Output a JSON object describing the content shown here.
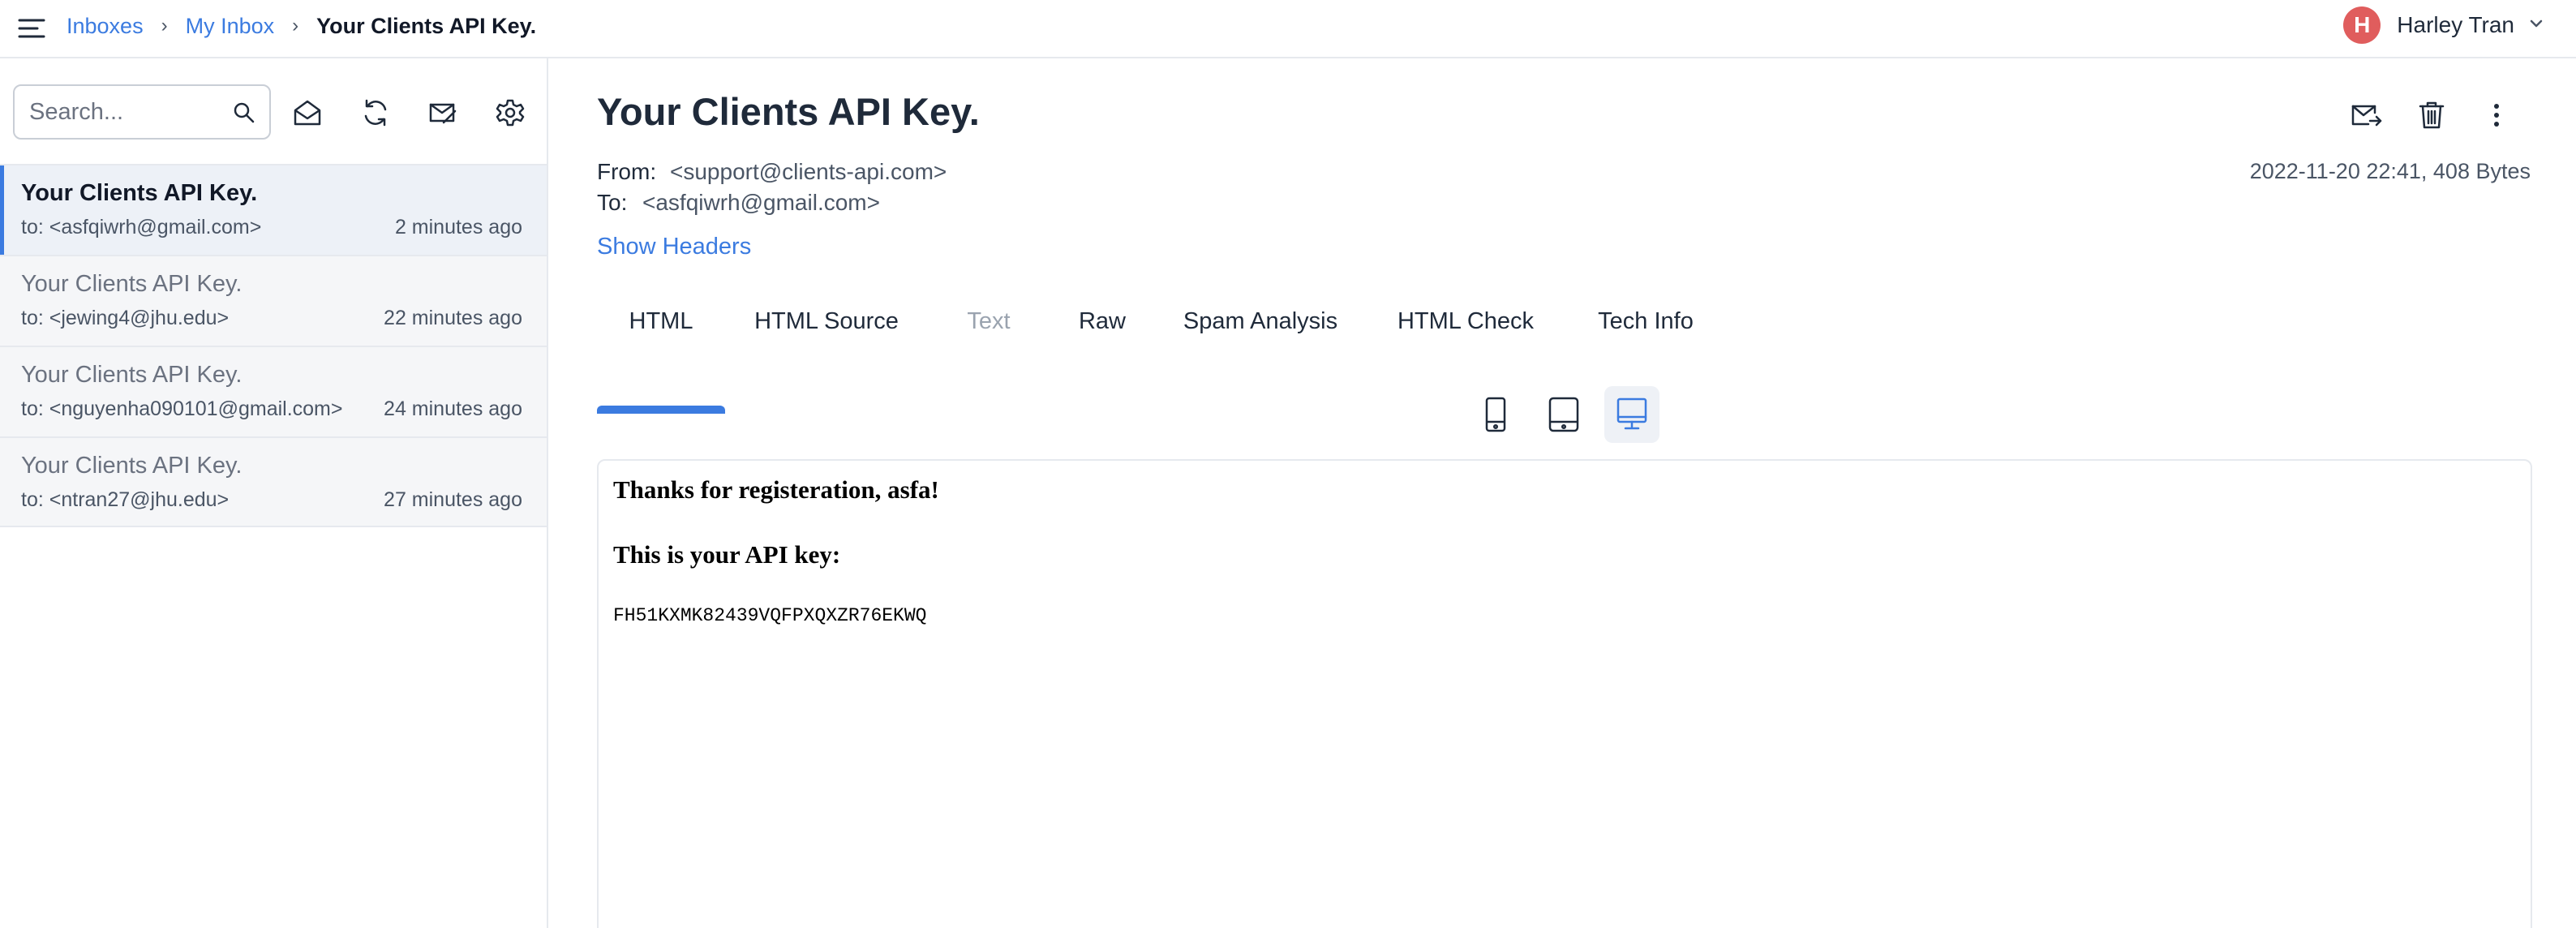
{
  "colors": {
    "accent": "#3b7be0",
    "avatar": "#e05d5d",
    "text": "#1f2a3a",
    "muted": "#6b7280"
  },
  "header": {
    "menu_icon": "hamburger-menu-icon",
    "breadcrumb": {
      "inboxes": "Inboxes",
      "my_inbox": "My Inbox",
      "current": "Your Clients API Key.",
      "separator": "›"
    },
    "user": {
      "initial": "H",
      "name": "Harley Tran"
    }
  },
  "sidebar": {
    "search": {
      "placeholder": "Search..."
    },
    "toolbar_icons": [
      "envelope-open-icon",
      "refresh-icon",
      "mark-read-icon",
      "settings-gear-icon"
    ],
    "messages": [
      {
        "subject": "Your Clients API Key.",
        "to": "to: <asfqiwrh@gmail.com>",
        "time": "2 minutes ago"
      },
      {
        "subject": "Your Clients API Key.",
        "to": "to: <jewing4@jhu.edu>",
        "time": "22 minutes ago"
      },
      {
        "subject": "Your Clients API Key.",
        "to": "to: <nguyenha090101@gmail.com>",
        "time": "24 minutes ago"
      },
      {
        "subject": "Your Clients API Key.",
        "to": "to: <ntran27@jhu.edu>",
        "time": "27 minutes ago"
      }
    ]
  },
  "message": {
    "subject": "Your Clients API Key.",
    "from_label": "From:",
    "from": "<support@clients-api.com>",
    "to_label": "To:",
    "to": "<asfqiwrh@gmail.com>",
    "date_size": "2022-11-20 22:41, 408 Bytes",
    "show_headers": "Show Headers",
    "action_icons": [
      "forward-mail-icon",
      "trash-icon",
      "more-vertical-icon"
    ],
    "tabs": [
      "HTML",
      "HTML Source",
      "Text",
      "Raw",
      "Spam Analysis",
      "HTML Check",
      "Tech Info"
    ],
    "active_tab": "HTML",
    "disabled_tab": "Text",
    "device_icons": [
      "phone-icon",
      "tablet-icon",
      "desktop-icon"
    ],
    "active_device": "desktop-icon",
    "body": {
      "greeting": "Thanks for registeration, asfa!",
      "label": "This is your API key:",
      "api_key": "FH51KXMK82439VQFPXQXZR76EKWQ"
    }
  }
}
